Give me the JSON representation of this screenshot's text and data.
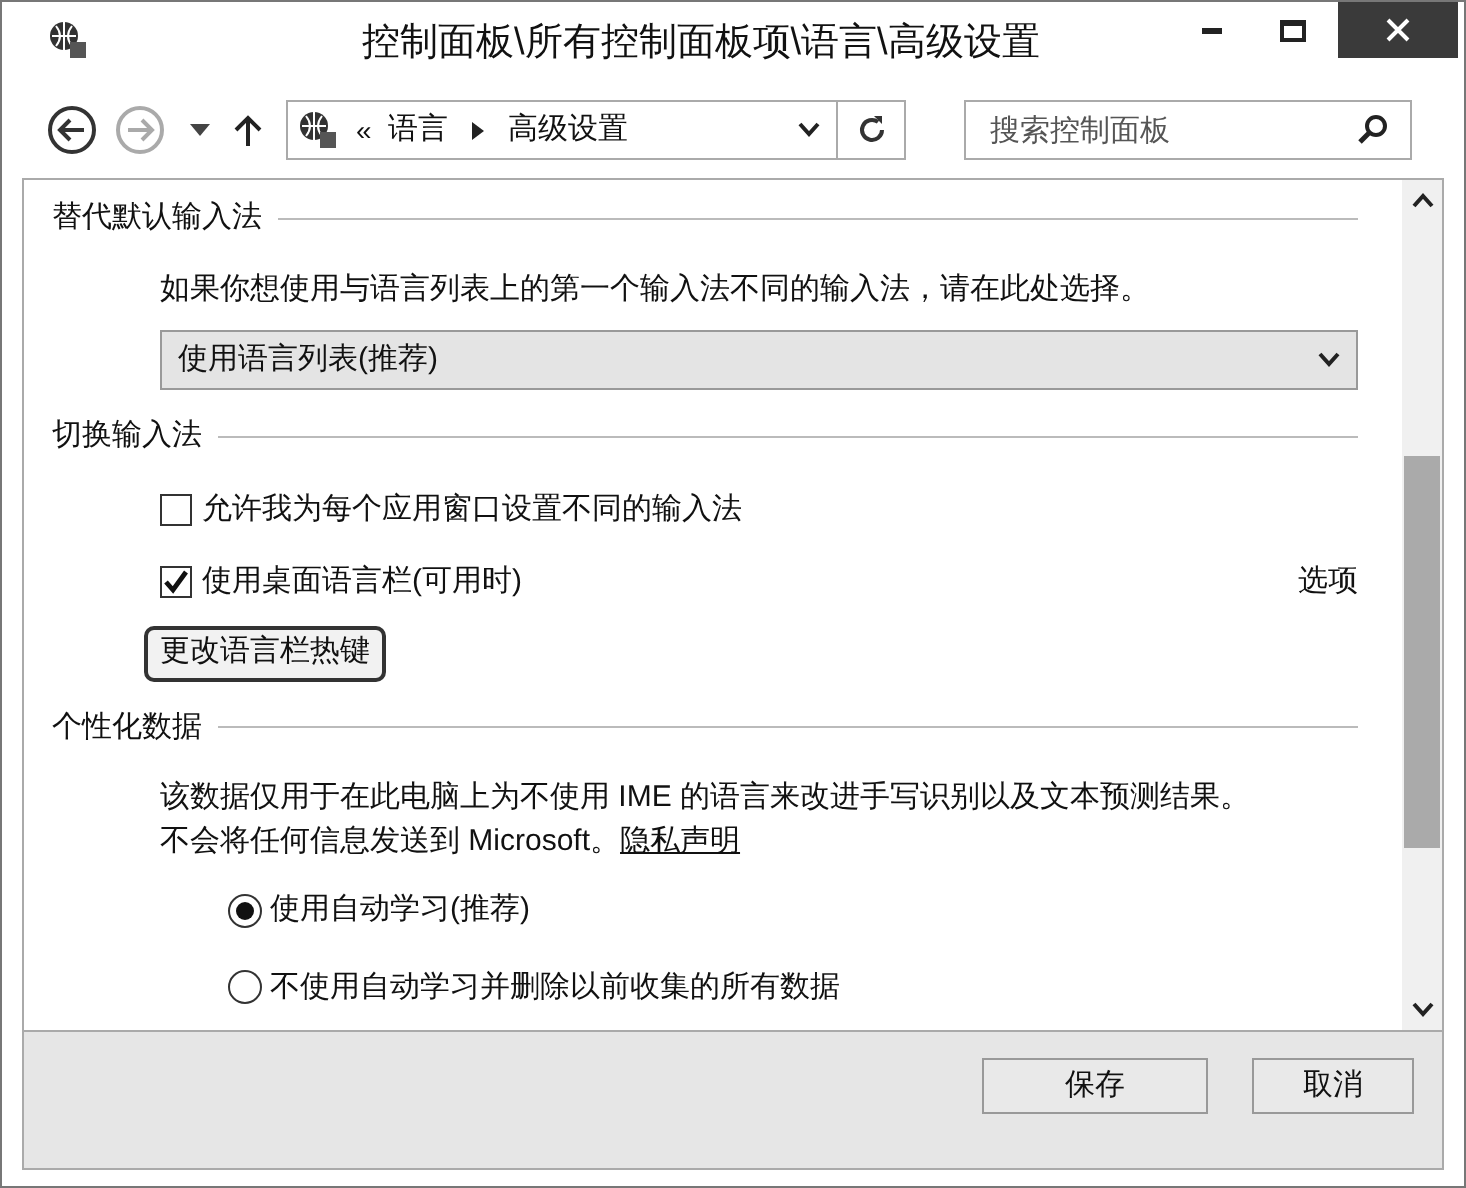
{
  "window": {
    "title": "控制面板\\所有控制面板项\\语言\\高级设置"
  },
  "toolbar": {
    "overflow": "«",
    "path": [
      "语言",
      "高级设置"
    ],
    "search": {
      "placeholder": "搜索控制面板"
    }
  },
  "sections": [
    {
      "heading": "替代默认输入法",
      "items": [
        {
          "kind": "text",
          "text": "如果你想使用与语言列表上的第一个输入法不同的输入法，请在此处选择。"
        },
        {
          "kind": "dropdown",
          "value": "使用语言列表(推荐)"
        }
      ]
    },
    {
      "heading": "切换输入法",
      "items": [
        {
          "kind": "checkbox",
          "label": "允许我为每个应用窗口设置不同的输入法",
          "checked": false
        },
        {
          "kind": "checkbox",
          "label": "使用桌面语言栏(可用时)",
          "checked": true,
          "link": "选项"
        },
        {
          "kind": "button",
          "label": "更改语言栏热键"
        }
      ]
    },
    {
      "heading": "个性化数据",
      "items": [
        {
          "kind": "paragraph",
          "lines": [
            "该数据仅用于在此电脑上为不使用 IME 的语言来改进手写识别以及文本预测结果。",
            "不会将任何信息发送到 Microsoft。"
          ],
          "link": "隐私声明"
        },
        {
          "kind": "radio",
          "label": "使用自动学习(推荐)",
          "selected": true
        },
        {
          "kind": "radio",
          "label": "不使用自动学习并删除以前收集的所有数据",
          "selected": false
        }
      ]
    }
  ],
  "buttons": [
    "保存",
    "取消"
  ]
}
